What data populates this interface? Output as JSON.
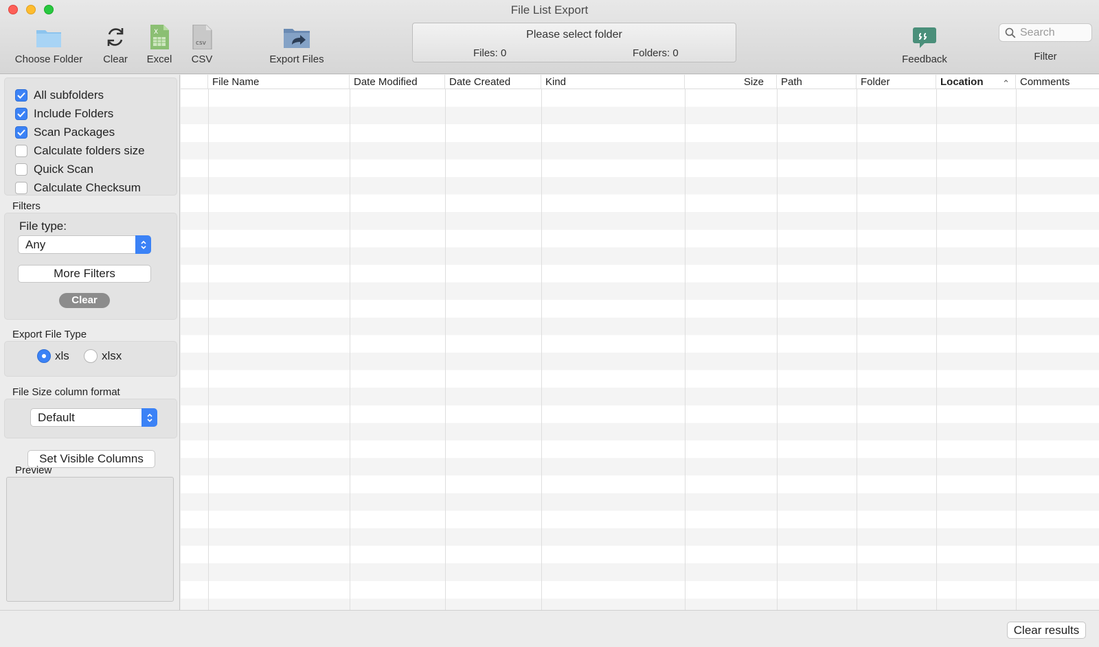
{
  "window": {
    "title": "File List Export"
  },
  "toolbar": {
    "choose_folder": {
      "label": "Choose Folder",
      "icon": "folder-icon"
    },
    "clear": {
      "label": "Clear",
      "icon": "refresh-icon"
    },
    "excel": {
      "label": "Excel",
      "icon": "excel-icon",
      "badge": "X"
    },
    "csv": {
      "label": "CSV",
      "icon": "csv-icon",
      "badge": "csv"
    },
    "export_files": {
      "label": "Export Files",
      "icon": "export-folder-icon"
    },
    "feedback": {
      "label": "Feedback",
      "icon": "speech-bubble-icon"
    },
    "filter": {
      "label": "Filter"
    },
    "search": {
      "placeholder": "Search",
      "icon": "search-icon"
    }
  },
  "status": {
    "message": "Please select folder",
    "files": "Files: 0",
    "folders": "Folders: 0"
  },
  "options": [
    {
      "label": "All subfolders",
      "checked": true
    },
    {
      "label": "Include Folders",
      "checked": true
    },
    {
      "label": "Scan Packages",
      "checked": true
    },
    {
      "label": "Calculate folders size",
      "checked": false
    },
    {
      "label": "Quick Scan",
      "checked": false
    },
    {
      "label": "Calculate Checksum",
      "checked": false
    }
  ],
  "filters": {
    "section_label": "Filters",
    "file_type_label": "File type:",
    "file_type_value": "Any",
    "more_filters": "More Filters",
    "clear": "Clear"
  },
  "export_type": {
    "section_label": "Export File Type",
    "options": [
      {
        "label": "xls",
        "selected": true
      },
      {
        "label": "xlsx",
        "selected": false
      }
    ]
  },
  "size_format": {
    "section_label": "File Size column format",
    "value": "Default"
  },
  "set_visible_columns": "Set Visible Columns",
  "preview_label": "Preview",
  "table": {
    "columns": [
      "",
      "File Name",
      "Date Modified",
      "Date Created",
      "Kind",
      "Size",
      "Path",
      "Folder",
      "Location",
      "Comments"
    ],
    "sorted_column": "Location",
    "sort_direction": "ascending",
    "rows": []
  },
  "footer": {
    "clear_results": "Clear results"
  },
  "colors": {
    "accent": "#3b82f6",
    "pill": "#8c8c8c"
  }
}
